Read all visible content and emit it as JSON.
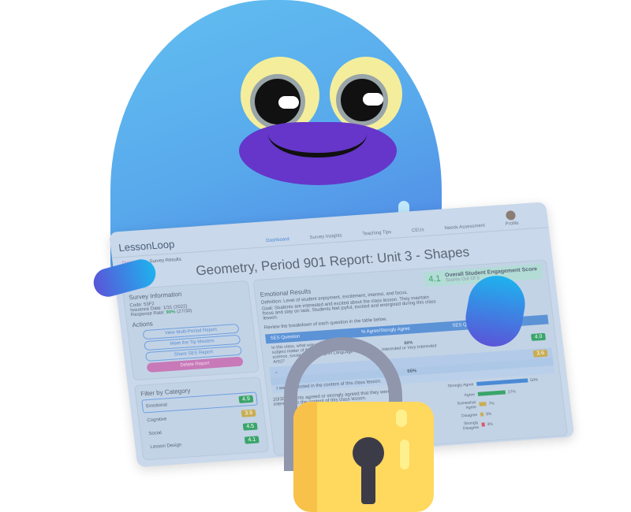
{
  "nav": {
    "logo": "LessonLoop",
    "items": [
      "Dashboard",
      "Survey Insights",
      "Teaching Tips",
      "CEUs",
      "Needs Assessment"
    ],
    "profile": "Profile"
  },
  "breadcrumb": {
    "home": "Dashboard",
    "sep": "›",
    "current": "Survey Results"
  },
  "page_title": "Geometry, Period 901 Report: Unit 3 - Shapes",
  "survey_info": {
    "heading": "Survey Information",
    "code": "Code: 53F2",
    "date": "Issuance Date: 1/31 (2022)",
    "rate_label": "Response Rate:",
    "rate_value": "90%",
    "rate_count": "(27/30)"
  },
  "actions": {
    "heading": "Actions",
    "buttons": [
      "View Multi-Period Report",
      "Meet the Tip Masters",
      "Share SES Report"
    ],
    "delete": "Delete Report"
  },
  "filter": {
    "heading": "Filter by Category",
    "items": [
      {
        "label": "Emotional",
        "score": "4.9",
        "color": "green"
      },
      {
        "label": "Cognitive",
        "score": "3.9",
        "color": "yellow"
      },
      {
        "label": "Social",
        "score": "4.5",
        "color": "green"
      },
      {
        "label": "Lesson Design",
        "score": "4.1",
        "color": "green"
      }
    ]
  },
  "results": {
    "heading": "Emotional Results",
    "definition": "Definition: Level of student enjoyment, excitement, interest, and focus.",
    "goal": "Goal: Students are interested and excited about the class lesson. They maintain focus and stay on task. Students feel joyful, excited and energized during this class lesson.",
    "review": "Review the breakdown of each question in the table below.",
    "score": {
      "value": "4.1",
      "label": "Overall Student Engagement Score",
      "sub": "Scores Out Of 5"
    },
    "table_headers": [
      "SES Question",
      "% Agree/Stongly Agree",
      "SES Question Score"
    ],
    "rows": [
      {
        "question": "In this class, what was your interest in the subject matter of this course (e.g., math, science, social studies, English Language Arts)?",
        "pct": "80%",
        "pct_note": "Interested or Very Interested",
        "score": "4.0"
      },
      {
        "question": "",
        "pct": "66%",
        "pct_note": "",
        "score": "3.6"
      }
    ],
    "expanded_question": "I was interested in the content of this class lesson.",
    "summary": "20/30 students agreed or strongly agreed that they were interested in the content of this class lesson."
  },
  "chart_data": {
    "type": "bar",
    "categories": [
      "Strongly Agree",
      "Agree",
      "Somewhat Agree",
      "Disagree",
      "Strongly Disagree"
    ],
    "values": [
      50,
      27,
      7,
      3,
      3
    ],
    "labels": [
      "50%",
      "27%",
      "7%",
      "3%",
      "3%"
    ],
    "colors": [
      "#4a8ad6",
      "#3aa56a",
      "#c9ad53",
      "#c9ad53",
      "#d95a6a"
    ]
  }
}
